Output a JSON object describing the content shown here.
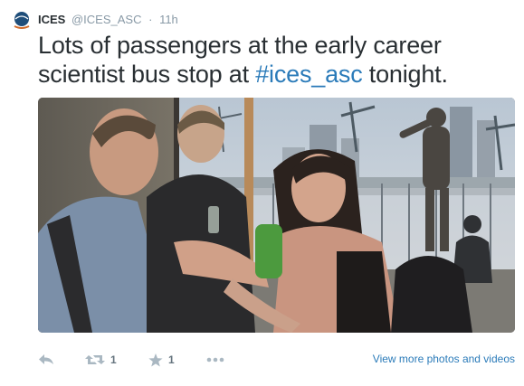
{
  "account": {
    "display_name": "ICES",
    "handle": "@ICES_ASC",
    "separator": "·",
    "timestamp": "11h"
  },
  "tweet": {
    "text_before": "Lots of passengers at the early career scientist bus stop at ",
    "hashtag": "#ices_asc",
    "text_after": " tonight."
  },
  "actions": {
    "reply_icon": "reply-icon",
    "retweet_icon": "retweet-icon",
    "retweet_count": "1",
    "favorite_icon": "star-icon",
    "favorite_count": "1",
    "more_icon": "more-dots-icon",
    "view_more_label": "View more photos and videos"
  },
  "colors": {
    "link": "#2b7bb9",
    "text": "#292f33",
    "muted": "#8899a6",
    "action_icon": "#aab8c2"
  }
}
